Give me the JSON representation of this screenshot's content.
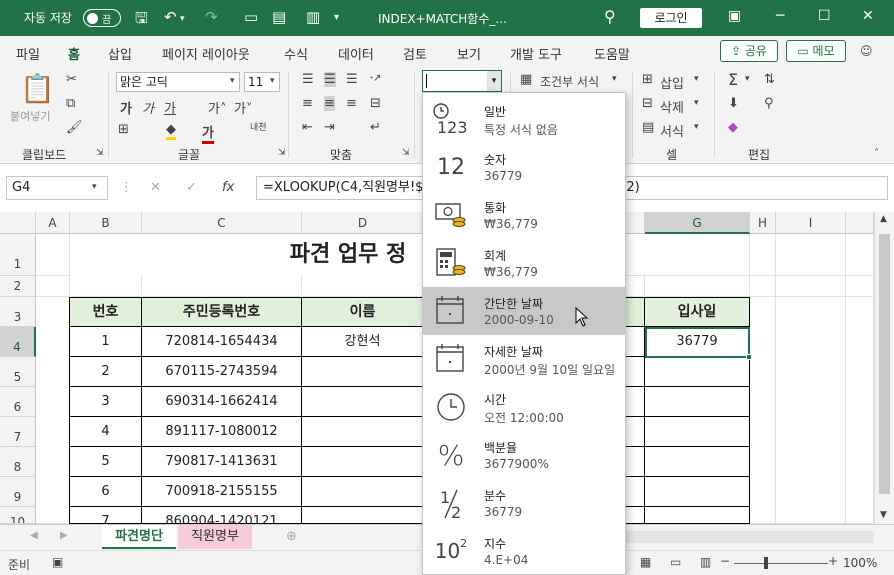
{
  "titlebar": {
    "autosave_label": "자동 저장",
    "autosave_state": "끔",
    "doc_title": "INDEX+MATCH함수_...",
    "login_label": "로그인"
  },
  "ribbon_tabs": [
    "파일",
    "홈",
    "삽입",
    "페이지 레이아웃",
    "수식",
    "데이터",
    "검토",
    "보기",
    "개발 도구",
    "도움말"
  ],
  "share_label": "공유",
  "memo_label": "메모",
  "ribbon": {
    "paste_label": "붙여넣기",
    "font_name": "맑은 고딕",
    "font_size": "11",
    "conditional_format": "조건부 서식",
    "insert_label": "삽입",
    "delete_label": "삭제",
    "format_label": "서식",
    "groups": {
      "clipboard": "클립보드",
      "font": "글꼴",
      "alignment": "맞춤",
      "cells": "셀",
      "editing": "편집"
    }
  },
  "formula_bar": {
    "name_box": "G4",
    "formula": "=XLOOKUP(C4,직원명부!$C$2:$C$52,직원명부!$H$2:$H$52)"
  },
  "columns": [
    "A",
    "B",
    "C",
    "D",
    "E",
    "F",
    "G",
    "H",
    "I"
  ],
  "rows": [
    "1",
    "2",
    "3",
    "4",
    "5",
    "6",
    "7",
    "8",
    "9",
    "10"
  ],
  "sheet_title": "파견 업무 정",
  "table_headers": {
    "b": "번호",
    "c": "주민등록번호",
    "d": "이름",
    "g": "입사일"
  },
  "table_rows": [
    {
      "num": "1",
      "id": "720814-1654434",
      "name": "강현석",
      "date": "36779"
    },
    {
      "num": "2",
      "id": "670115-2743594",
      "name": "",
      "date": ""
    },
    {
      "num": "3",
      "id": "690314-1662414",
      "name": "",
      "date": ""
    },
    {
      "num": "4",
      "id": "891117-1080012",
      "name": "",
      "date": ""
    },
    {
      "num": "5",
      "id": "790817-1413631",
      "name": "",
      "date": ""
    },
    {
      "num": "6",
      "id": "700918-2155155",
      "name": "",
      "date": ""
    },
    {
      "num": "7",
      "id": "860904-1420121",
      "name": "",
      "date": ""
    }
  ],
  "sheets": [
    "파견명단",
    "직원명부"
  ],
  "status": {
    "ready": "준비",
    "zoom": "100%"
  },
  "number_formats": [
    {
      "name": "일반",
      "sample": "특정 서식 없음",
      "icon": "clock-123-icon"
    },
    {
      "name": "숫자",
      "sample": "36779",
      "icon": "number-12-icon"
    },
    {
      "name": "통화",
      "sample": "₩36,779",
      "icon": "currency-icon"
    },
    {
      "name": "회계",
      "sample": "₩36,779",
      "icon": "accounting-icon"
    },
    {
      "name": "간단한 날짜",
      "sample": "2000-09-10",
      "icon": "calendar-short-icon"
    },
    {
      "name": "자세한 날짜",
      "sample": "2000년 9월 10일 일요일",
      "icon": "calendar-long-icon"
    },
    {
      "name": "시간",
      "sample": "오전 12:00:00",
      "icon": "clock-icon"
    },
    {
      "name": "백분율",
      "sample": "3677900%",
      "icon": "percent-icon"
    },
    {
      "name": "분수",
      "sample": "36779",
      "icon": "fraction-icon"
    },
    {
      "name": "지수",
      "sample": "4.E+04",
      "icon": "scientific-icon"
    }
  ],
  "icons": {
    "clock_digits": "123",
    "number_digits": "12",
    "percent_glyph": "%",
    "fraction_numerator": "1",
    "fraction_denominator": "2",
    "exponent_base": "10",
    "exponent_power": "2"
  },
  "colors": {
    "accent": "#217346",
    "table_header": "#e2efda",
    "hover": "#c8c8c8"
  }
}
